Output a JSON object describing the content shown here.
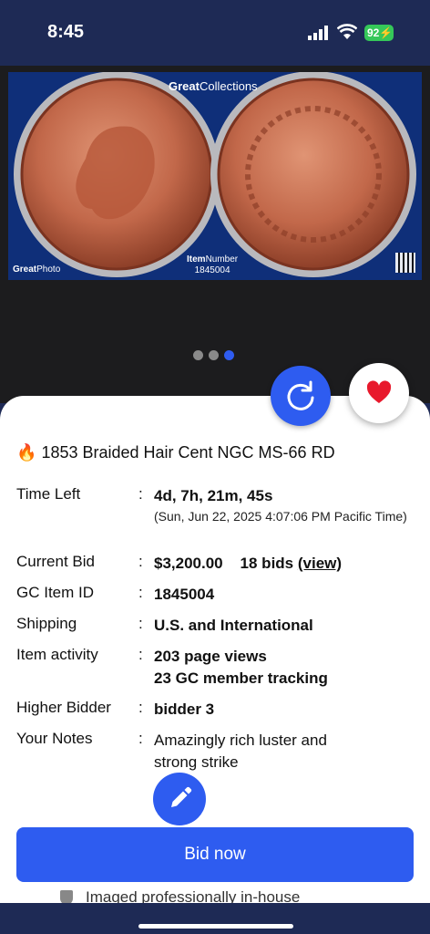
{
  "status_bar": {
    "time": "8:45",
    "battery": "92"
  },
  "banner": {
    "brand_bold": "Great",
    "brand_rest": "Collections",
    "photo_bold": "Great",
    "photo_rest": "Photo",
    "item_number_label_bold": "Item",
    "item_number_label_rest": "Number",
    "item_number": "1845004"
  },
  "carousel": {
    "page_count": 3,
    "active_index": 2
  },
  "listing": {
    "title": "1853 Braided Hair Cent NGC MS-66 RD",
    "rows": {
      "time_left": {
        "label": "Time Left",
        "value": "4d, 7h, 21m, 45s",
        "sub": "(Sun, Jun 22, 2025 4:07:06 PM Pacific Time)"
      },
      "current_bid": {
        "label": "Current Bid",
        "value": "$3,200.00",
        "bids": "18 bids",
        "view": "(view)"
      },
      "item_id": {
        "label": "GC Item ID",
        "value": "1845004"
      },
      "shipping": {
        "label": "Shipping",
        "value": "U.S. and International"
      },
      "activity": {
        "label": "Item activity",
        "value1": "203 page views",
        "value2": "23 GC member tracking"
      },
      "high_bidder": {
        "label": "Higher Bidder",
        "value": "bidder 3"
      },
      "notes": {
        "label": "Your Notes",
        "value1": "Amazingly rich luster and",
        "value2": "strong strike"
      }
    },
    "colon": ":"
  },
  "bid_button": {
    "label": "Bid now"
  },
  "footer": {
    "text": "Imaged professionally in-house"
  },
  "colors": {
    "accent": "#2e5cf0",
    "navy": "#1e2a55",
    "heart": "#e8192c"
  }
}
